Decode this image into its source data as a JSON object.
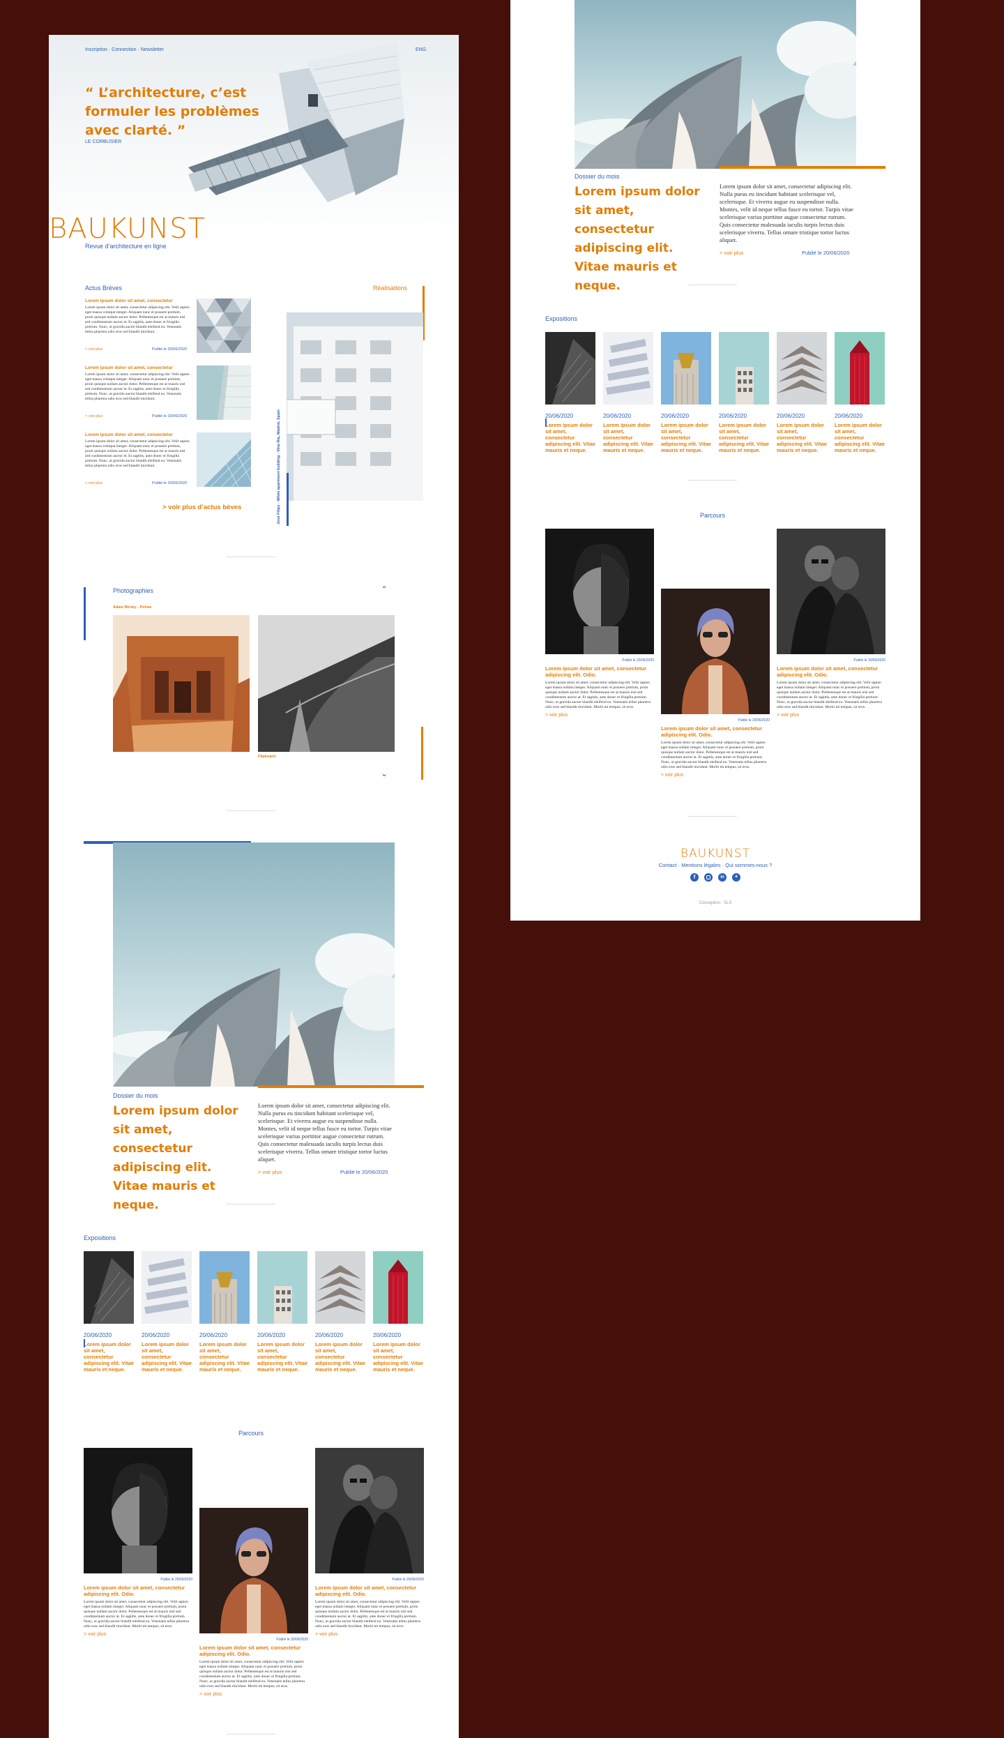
{
  "colors": {
    "bg": "#451009",
    "accent": "#e27d06",
    "blue": "#2e5fb5"
  },
  "nav": {
    "inscription": "Inscription",
    "sep1": "·",
    "connection": "Connection",
    "sep2": "·",
    "newsletter": "Newsletter",
    "lang": "ENG"
  },
  "hero": {
    "quote": "“ L’architecture, c’est formuler les problèmes avec clarté. ”",
    "author": "LE CORBUSIER"
  },
  "brand": {
    "logo": "BAUKUNST",
    "tagline": "Revue d’architecture en ligne"
  },
  "actus": {
    "heading": "Actus Brèves",
    "items": [
      {
        "title": "Lorem ipsum dolor sit amet, consectetur",
        "text": "Lorem ipsum dolor sit amet, consectetur adipiscing elit. Velit sapien eget massa volutpat integer. Aliquam nunc et posuere pretium, proin quisque nullam auctor dolor. Pellentesque est at mauris nisl sed condimentum auctor et. Et sagittis, ante donec et fringilla pretium. Nunc, ut gravida auctor blandit eleifend eu. Venenatis tellus pharetra odio eros sed blandit tincidunt.",
        "more": "> voir plus",
        "date": "Publié le 20/06/2020"
      },
      {
        "title": "Lorem ipsum dolor sit amet, consectetur",
        "text": "Lorem ipsum dolor sit amet, consectetur adipiscing elit. Velit sapien eget massa volutpat integer. Aliquam nunc et posuere pretium, proin quisque nullam auctor dolor. Pellentesque est at mauris nisl sed condimentum auctor et. Et sagittis, ante donec et fringilla pretium. Nunc, ut gravida auctor blandit eleifend eu. Venenatis tellus pharetra odio eros sed blandit tincidunt.",
        "more": "> voir plus",
        "date": "Publié le 20/06/2020"
      },
      {
        "title": "Lorem ipsum dolor sit amet, consectetur",
        "text": "Lorem ipsum dolor sit amet, consectetur adipiscing elit. Velit sapien eget massa volutpat integer. Aliquam nunc et posuere pretium, proin quisque nullam auctor dolor. Pellentesque est at mauris nisl sed condimentum auctor et. Et sagittis, ante donec et fringilla pretium. Nunc, ut gravida auctor blandit eleifend eu. Venenatis tellus pharetra odio eros sed blandit tincidunt.",
        "more": "> voir plus",
        "date": "Publié le 20/06/2020"
      }
    ],
    "more_all": "> voir plus d’actus bèves"
  },
  "realisations": {
    "heading": "Réalisations",
    "caption": "José Filipe - White apartment building - Vina Ria, Madrid, Spain"
  },
  "photos": {
    "heading": "Photographies",
    "credit1": "Adam Birsky - Petras",
    "credit2": "Flipboard"
  },
  "dossier": {
    "label": "Dossier du mois",
    "title": "Lorem ipsum dolor sit amet, consectetur adipiscing elit. Vitae mauris et neque.",
    "text": "Lorem ipsum dolor sit amet, consectetur adipiscing elit. Nulla purus eu tincidunt habitant scelerisque vel, scelerisque. Et viverra augue eu suspendisse nulla. Montes, velit id neque tellus fusce eu tortor. Turpis vitae scelerisque varius porttitor augue consectetur rutrum. Quis consectetur malesuada iaculis turpis lectus duis scelerisque viverra. Tellus ornare tristique tortor luctus aliquet.",
    "more": "> voir plus",
    "date": "Publié le 20/06/2020"
  },
  "expos": {
    "heading": "Expositions",
    "items": [
      {
        "date": "20/06/2020",
        "title": "Lorem ipsum dolor sit amet, consectetur adipiscing elit. Vitae mauris et neque."
      },
      {
        "date": "20/06/2020",
        "title": "Lorem ipsum dolor sit amet, consectetur adipiscing elit. Vitae mauris et neque."
      },
      {
        "date": "20/06/2020",
        "title": "Lorem ipsum dolor sit amet, consectetur adipiscing elit. Vitae mauris et neque."
      },
      {
        "date": "20/06/2020",
        "title": "Lorem ipsum dolor sit amet, consectetur adipiscing elit. Vitae mauris et neque."
      },
      {
        "date": "20/06/2020",
        "title": "Lorem ipsum dolor sit amet, consectetur adipiscing elit. Vitae mauris et neque."
      },
      {
        "date": "20/06/2020",
        "title": "Lorem ipsum dolor sit amet, consectetur adipiscing elit. Vitae mauris et neque."
      }
    ]
  },
  "parcours": {
    "heading": "Parcours",
    "items": [
      {
        "date": "Publié le 20/06/2020",
        "title": "Lorem ipsum dolor sit amet, consectetur adipiscing elit. Odio.",
        "text": "Lorem ipsum dolor sit amet, consectetur adipiscing elit. Velit sapien eget massa nullam integer. Aliquam nunc et posuere pretium, proin quisque nullam auctor dolor. Pellentesque est at mauris nisl sed condimentum auctor at. Et sagittis, ante donec et fringilla pretium. Nunc, ut gravida auctor blandit eleifend eu. Venenatis tellus pharetra odio eros sed blandit tincidunt. Morbi mi tempus, sit eros.",
        "more": "> voir plus"
      },
      {
        "date": "Publié le 20/06/2020",
        "title": "Lorem ipsum dolor sit amet, consectetur adipiscing elit. Odio.",
        "text": "Lorem ipsum dolor sit amet, consectetur adipiscing elit. Velit sapien eget massa nullam integer. Aliquam nunc et posuere pretium, proin quisque nullam auctor dolor. Pellentesque est at mauris nisl sed condimentum auctor at. Et sagittis, ante donec et fringilla pretium. Nunc, ut gravida auctor blandit eleifend eu. Venenatis tellus pharetra odio eros sed blandit tincidunt. Morbi mi tempus, sit eros.",
        "more": "> voir plus"
      },
      {
        "date": "Publié le 20/06/2020",
        "title": "Lorem ipsum dolor sit amet, consectetur adipiscing elit. Odio.",
        "text": "Lorem ipsum dolor sit amet, consectetur adipiscing elit. Velit sapien eget massa nullam integer. Aliquam nunc et posuere pretium, proin quisque nullam auctor dolor. Pellentesque est at mauris nisl sed condimentum auctor at. Et sagittis, ante donec et fringilla pretium. Nunc, ut gravida auctor blandit eleifend eu. Venenatis tellus pharetra odio eros sed blandit tincidunt. Morbi mi tempus, sit eros.",
        "more": "> voir plus"
      }
    ]
  },
  "footer": {
    "logo": "BAUKUNST",
    "links": "Contact · Mentions légales · Qui sommes-nous ?",
    "social": [
      "facebook-icon",
      "instagram-icon",
      "linkedin-icon",
      "twitter-icon"
    ],
    "credit": "Conception : SLS"
  }
}
